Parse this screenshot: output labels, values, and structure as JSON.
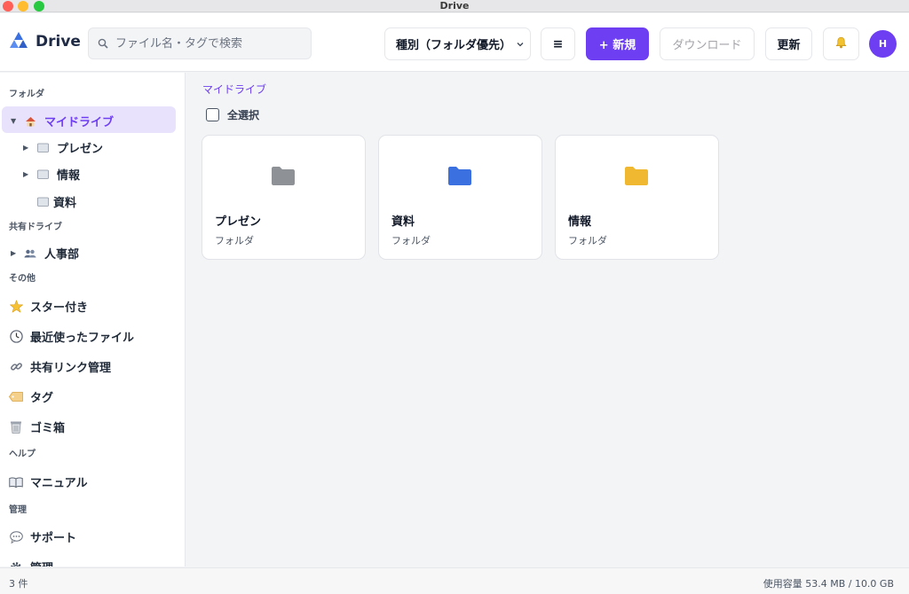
{
  "window": {
    "title": "Drive"
  },
  "header": {
    "logo_text": "Drive",
    "search_placeholder": "ファイル名・タグで検索",
    "sort_selected": "種別（フォルダ優先）",
    "menu_label": "≡",
    "new_label": "+ 新規",
    "download_label": "ダウンロード",
    "refresh_label": "更新",
    "avatar_initial": "H"
  },
  "sidebar": {
    "folders_label": "フォルダ",
    "my_drive": "マイドライブ",
    "sub_presen": "プレゼン",
    "sub_joho": "情報",
    "sub_shiryo": "資料",
    "shared_label": "共有ドライブ",
    "shared_hr": "人事部",
    "other_label": "その他",
    "starred": "スター付き",
    "recent": "最近使ったファイル",
    "shared_links": "共有リンク管理",
    "tags": "タグ",
    "trash": "ゴミ箱",
    "help_label": "ヘルプ",
    "manual": "マニュアル",
    "admin_label": "管理",
    "support": "サポート",
    "admin_item": "管理"
  },
  "main": {
    "breadcrumb": "マイドライブ",
    "select_all": "全選択",
    "cards": [
      {
        "name": "プレゼン",
        "kind": "フォルダ",
        "color": "#8e9196"
      },
      {
        "name": "資料",
        "kind": "フォルダ",
        "color": "#3b70e0"
      },
      {
        "name": "情報",
        "kind": "フォルダ",
        "color": "#f0b731"
      }
    ]
  },
  "status": {
    "count": "3 件",
    "usage": "使用容量 53.4 MB / 10.0 GB"
  },
  "colors": {
    "accent": "#6d3ef2",
    "active_bg": "#e9e2fc"
  }
}
